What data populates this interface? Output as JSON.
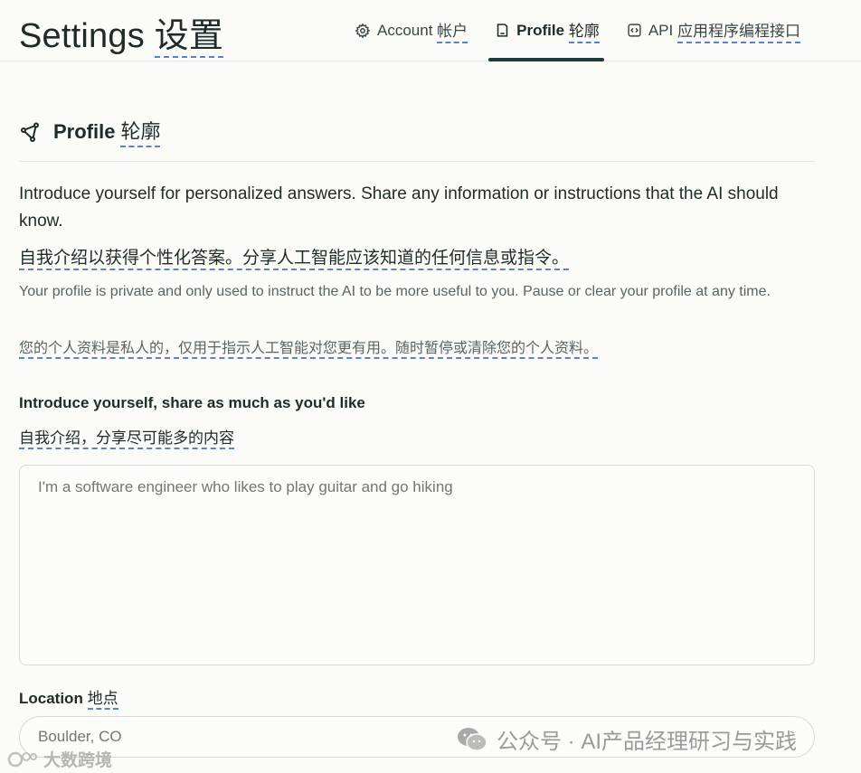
{
  "header": {
    "title": "Settings",
    "title_cn": "设置",
    "tabs": [
      {
        "label": "Account",
        "label_cn": "帐户",
        "icon": "gear-icon"
      },
      {
        "label": "Profile",
        "label_cn": "轮廓",
        "icon": "profile-card-icon",
        "active": true
      },
      {
        "label": "API",
        "label_cn": "应用程序编程接口",
        "icon": "code-brackets-icon"
      }
    ]
  },
  "section": {
    "title": "Profile",
    "title_cn": "轮廓",
    "icon": "share-nodes-icon",
    "intro": "Introduce yourself for personalized answers. Share any information or instructions that the AI should know.",
    "intro_cn": "自我介绍以获得个性化答案。分享人工智能应该知道的任何信息或指令。",
    "privacy": "Your profile is private and only used to instruct the AI to be more useful to you. Pause or clear your profile at any time.",
    "privacy_cn": "您的个人资料是私人的，仅用于指示人工智能对您更有用。随时暂停或清除您的个人资料。"
  },
  "form": {
    "intro_label": "Introduce yourself, share as much as you'd like",
    "intro_label_cn": "自我介绍，分享尽可能多的内容",
    "intro_placeholder": "I'm a software engineer who likes to play guitar and go hiking",
    "location_label": "Location",
    "location_label_cn": "地点",
    "location_placeholder": "Boulder, CO"
  },
  "watermarks": {
    "wechat": "公众号 · AI产品经理研习与实践",
    "corner": "大数跨境"
  },
  "colors": {
    "background": "#fbfbf8",
    "text": "#1f2a2a",
    "active_tab_underline": "#1f3a3a",
    "translation_underline": "#5b7fd6"
  }
}
